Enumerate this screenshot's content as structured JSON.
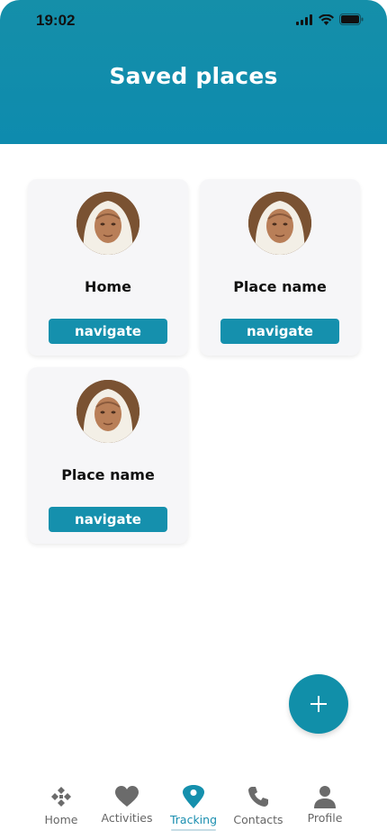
{
  "status_bar": {
    "time": "19:02"
  },
  "header": {
    "title": "Saved places"
  },
  "places": [
    {
      "name": "Home",
      "button_label": "navigate"
    },
    {
      "name": "Place name",
      "button_label": "navigate"
    },
    {
      "name": "Place name",
      "button_label": "navigate"
    }
  ],
  "fab": {
    "icon": "plus-icon",
    "label": "+"
  },
  "bottom_nav": {
    "items": [
      {
        "label": "Home",
        "icon": "home-icon"
      },
      {
        "label": "Activities",
        "icon": "heart-icon"
      },
      {
        "label": "Tracking",
        "icon": "location-pin-icon"
      },
      {
        "label": "Contacts",
        "icon": "phone-icon"
      },
      {
        "label": "Profile",
        "icon": "person-icon"
      }
    ],
    "active": "Tracking"
  },
  "colors": {
    "accent": "#118fa9",
    "header_bg": "#158fa9",
    "card_bg": "#f6f6f8",
    "nav_inactive": "#666666",
    "nav_active": "#1b8fb0"
  }
}
